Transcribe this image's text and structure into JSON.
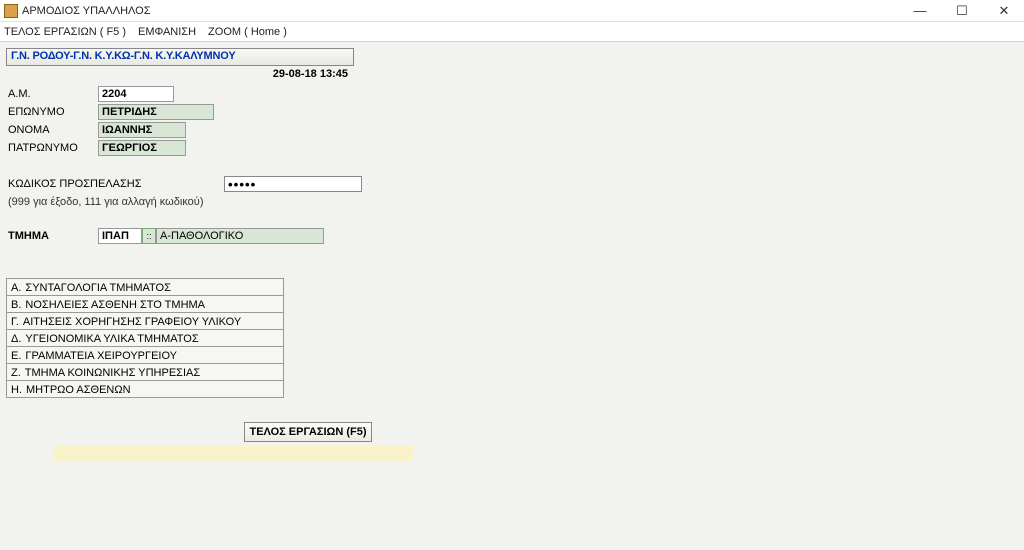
{
  "window": {
    "title": "ΑΡΜΟΔΙΟΣ ΥΠΑΛΛΗΛΟΣ"
  },
  "menu": {
    "telos": "ΤΕΛΟΣ ΕΡΓΑΣΙΩΝ ( F5 )",
    "emfanisi": "ΕΜΦΑΝΙΣΗ",
    "zoom": "ZOOM ( Home )"
  },
  "header": {
    "hospital": "Γ.Ν. ΡΟΔΟΥ-Γ.Ν. Κ.Υ.ΚΩ-Γ.Ν. Κ.Υ.ΚΑΛΥΜΝΟΥ",
    "timestamp": "29-08-18 13:45"
  },
  "labels": {
    "am": "Α.Μ.",
    "eponymo": "ΕΠΩΝΥΜΟ",
    "onoma": "ΟΝΟΜΑ",
    "patronymo": "ΠΑΤΡΩΝΥΜΟ",
    "access_code": "ΚΩΔΙΚΟΣ ΠΡΟΣΠΕΛΑΣΗΣ",
    "access_hint": "(999 για έξοδο, 111 για αλλαγή κωδικού)",
    "tmima": "ΤΜΗΜΑ"
  },
  "fields": {
    "am": "2204",
    "eponymo": "ΠΕΤΡΙΔΗΣ",
    "onoma": "ΙΩΑΝΝΗΣ",
    "patronymo": "ΓΕΩΡΓΙΟΣ",
    "access_code": "•••••",
    "tmima_code": "ΙΠΑΠ",
    "tmima_btn": "::",
    "tmima_desc": "Α-ΠΑΘΟΛΟΓΙΚΟ"
  },
  "menu_list": [
    {
      "prefix": "Α.",
      "label": "ΣΥΝΤΑΓΟΛΟΓΙΑ ΤΜΗΜΑΤΟΣ"
    },
    {
      "prefix": "Β.",
      "label": "ΝΟΣΗΛΕΙΕΣ  ΑΣΘΕΝΗ  ΣΤΟ  ΤΜΗΜΑ"
    },
    {
      "prefix": "Γ.",
      "label": "ΑΙΤΗΣΕΙΣ  ΧΟΡΗΓΗΣΗΣ  ΓΡΑΦΕΙΟΥ ΥΛΙΚΟΥ"
    },
    {
      "prefix": "Δ.",
      "label": "ΥΓΕΙΟΝΟΜΙΚΑ ΥΛΙΚΑ ΤΜΗΜΑΤΟΣ"
    },
    {
      "prefix": "Ε.",
      "label": "ΓΡΑΜΜΑΤΕΙΑ ΧΕΙΡΟΥΡΓΕΙΟΥ"
    },
    {
      "prefix": "Ζ.",
      "label": "ΤΜΗΜΑ ΚΟΙΝΩΝΙΚΗΣ ΥΠΗΡΕΣΙΑΣ"
    },
    {
      "prefix": "Η.",
      "label": "ΜΗΤΡΩΟ ΑΣΘΕΝΩΝ"
    }
  ],
  "buttons": {
    "telos_ergasion": "ΤΕΛΟΣ  ΕΡΓΑΣΙΩΝ (F5)"
  }
}
